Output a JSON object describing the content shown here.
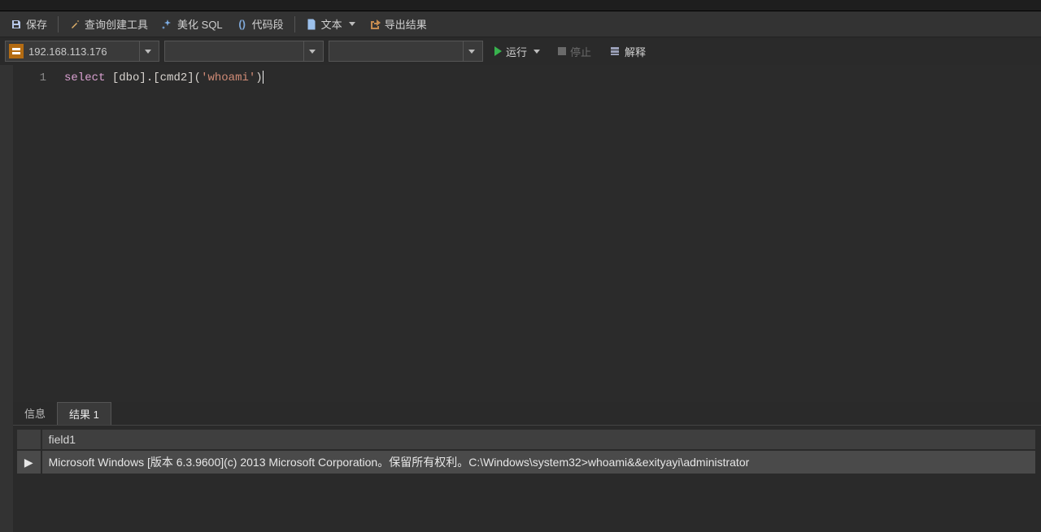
{
  "toolbar": {
    "save": "保存",
    "query_builder": "查询创建工具",
    "beautify": "美化 SQL",
    "snippet": "代码段",
    "text": "文本",
    "export": "导出结果"
  },
  "connection": {
    "host": "192.168.113.176"
  },
  "actions": {
    "run": "运行",
    "stop": "停止",
    "explain": "解释"
  },
  "editor": {
    "line_number": "1",
    "tokens": {
      "kw_select": "select",
      "space1": " ",
      "ident": "[dbo].[cmd2]",
      "lparen": "(",
      "str": "'whoami'",
      "rparen": ")"
    }
  },
  "bottom": {
    "tab_info": "信息",
    "tab_result": "结果 1",
    "column_header": "field1",
    "row_indicator": "▶",
    "cell_value": "Microsoft Windows [版本 6.3.9600](c) 2013 Microsoft Corporation。保留所有权利。C:\\Windows\\system32>whoami&&exityayi\\administrator"
  }
}
